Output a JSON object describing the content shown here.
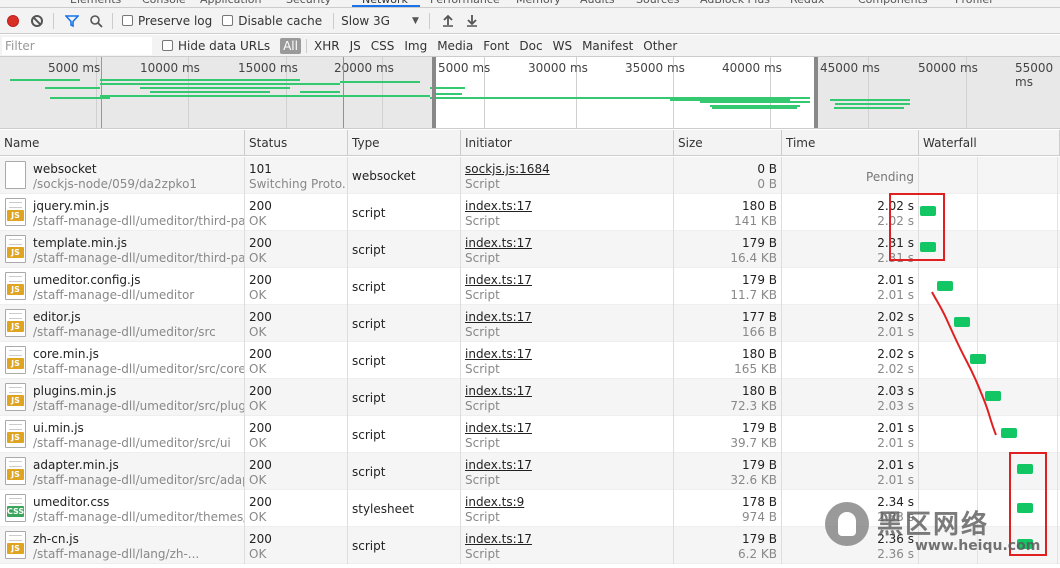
{
  "top_tabs": [
    "Elements",
    "Console",
    "Application",
    "Security",
    "Network",
    "Performance",
    "Memory",
    "Audits",
    "Sources",
    "AdBlock Plus",
    "Redux",
    "Components",
    "Profiler"
  ],
  "toolbar": {
    "preserve_log": "Preserve log",
    "disable_cache": "Disable cache",
    "throttle": "Slow 3G"
  },
  "filter": {
    "placeholder": "Filter",
    "hide_data_urls": "Hide data URLs",
    "types": [
      "All",
      "XHR",
      "JS",
      "CSS",
      "Img",
      "Media",
      "Font",
      "Doc",
      "WS",
      "Manifest",
      "Other"
    ]
  },
  "overview": {
    "ticks": [
      "5000 ms",
      "10000 ms",
      "15000 ms",
      "20000 ms",
      "5000 ms",
      "30000 ms",
      "35000 ms",
      "40000 ms",
      "45000 ms",
      "50000 ms",
      "55000 ms"
    ]
  },
  "columns": [
    "Name",
    "Status",
    "Type",
    "Initiator",
    "Size",
    "Time",
    "Waterfall"
  ],
  "rows": [
    {
      "icon": "document-icon",
      "name": "websocket",
      "path": "/sockjs-node/059/da2zpko1",
      "status": "101",
      "status_text": "Switching Proto...",
      "type": "websocket",
      "initiator": "sockjs.js:1684",
      "initiator_type": "Script",
      "size": "0 B",
      "size2": "0 B",
      "time": "Pending",
      "time2": ""
    },
    {
      "icon": "js-file-icon",
      "name": "jquery.min.js",
      "path": "/staff-manage-dll/umeditor/third-par...",
      "status": "200",
      "status_text": "OK",
      "type": "script",
      "initiator": "index.ts:17",
      "initiator_type": "Script",
      "size": "180 B",
      "size2": "141 KB",
      "time": "2.02 s",
      "time2": "2.02 s",
      "wf": 0
    },
    {
      "icon": "js-file-icon",
      "name": "template.min.js",
      "path": "/staff-manage-dll/umeditor/third-par...",
      "status": "200",
      "status_text": "OK",
      "type": "script",
      "initiator": "index.ts:17",
      "initiator_type": "Script",
      "size": "179 B",
      "size2": "16.4 KB",
      "time": "2.31 s",
      "time2": "2.31 s",
      "wf": 0
    },
    {
      "icon": "js-file-icon",
      "name": "umeditor.config.js",
      "path": "/staff-manage-dll/umeditor",
      "status": "200",
      "status_text": "OK",
      "type": "script",
      "initiator": "index.ts:17",
      "initiator_type": "Script",
      "size": "179 B",
      "size2": "11.7 KB",
      "time": "2.01 s",
      "time2": "2.01 s",
      "wf": 1
    },
    {
      "icon": "js-file-icon",
      "name": "editor.js",
      "path": "/staff-manage-dll/umeditor/src",
      "status": "200",
      "status_text": "OK",
      "type": "script",
      "initiator": "index.ts:17",
      "initiator_type": "Script",
      "size": "177 B",
      "size2": "166 B",
      "time": "2.02 s",
      "time2": "2.01 s",
      "wf": 2
    },
    {
      "icon": "js-file-icon",
      "name": "core.min.js",
      "path": "/staff-manage-dll/umeditor/src/core",
      "status": "200",
      "status_text": "OK",
      "type": "script",
      "initiator": "index.ts:17",
      "initiator_type": "Script",
      "size": "180 B",
      "size2": "165 KB",
      "time": "2.02 s",
      "time2": "2.02 s",
      "wf": 3
    },
    {
      "icon": "js-file-icon",
      "name": "plugins.min.js",
      "path": "/staff-manage-dll/umeditor/src/plugi...",
      "status": "200",
      "status_text": "OK",
      "type": "script",
      "initiator": "index.ts:17",
      "initiator_type": "Script",
      "size": "180 B",
      "size2": "72.3 KB",
      "time": "2.03 s",
      "time2": "2.03 s",
      "wf": 4
    },
    {
      "icon": "js-file-icon",
      "name": "ui.min.js",
      "path": "/staff-manage-dll/umeditor/src/ui",
      "status": "200",
      "status_text": "OK",
      "type": "script",
      "initiator": "index.ts:17",
      "initiator_type": "Script",
      "size": "179 B",
      "size2": "39.7 KB",
      "time": "2.01 s",
      "time2": "2.01 s",
      "wf": 5
    },
    {
      "icon": "js-file-icon",
      "name": "adapter.min.js",
      "path": "/staff-manage-dll/umeditor/src/adap...",
      "status": "200",
      "status_text": "OK",
      "type": "script",
      "initiator": "index.ts:17",
      "initiator_type": "Script",
      "size": "179 B",
      "size2": "32.6 KB",
      "time": "2.01 s",
      "time2": "2.01 s",
      "wf": 6
    },
    {
      "icon": "css-file-icon",
      "name": "umeditor.css",
      "path": "/staff-manage-dll/umeditor/themes/...",
      "status": "200",
      "status_text": "OK",
      "type": "stylesheet",
      "initiator": "index.ts:9",
      "initiator_type": "Script",
      "size": "178 B",
      "size2": "974 B",
      "time": "2.34 s",
      "time2": "2.33 s",
      "wf": 6
    },
    {
      "icon": "js-file-icon",
      "name": "zh-cn.js",
      "path": "/staff-manage-dll/lang/zh-...",
      "status": "200",
      "status_text": "OK",
      "type": "script",
      "initiator": "index.ts:17",
      "initiator_type": "Script",
      "size": "179 B",
      "size2": "6.2 KB",
      "time": "2.36 s",
      "time2": "2.36 s",
      "wf": 6
    }
  ],
  "watermark": {
    "title": "黑区网络",
    "url": "www.heiqu.com"
  },
  "colors": {
    "record": "#d93025",
    "waterfall_bar": "#12c664",
    "annotation": "#e02020",
    "active_tab": "#1a73e8"
  }
}
